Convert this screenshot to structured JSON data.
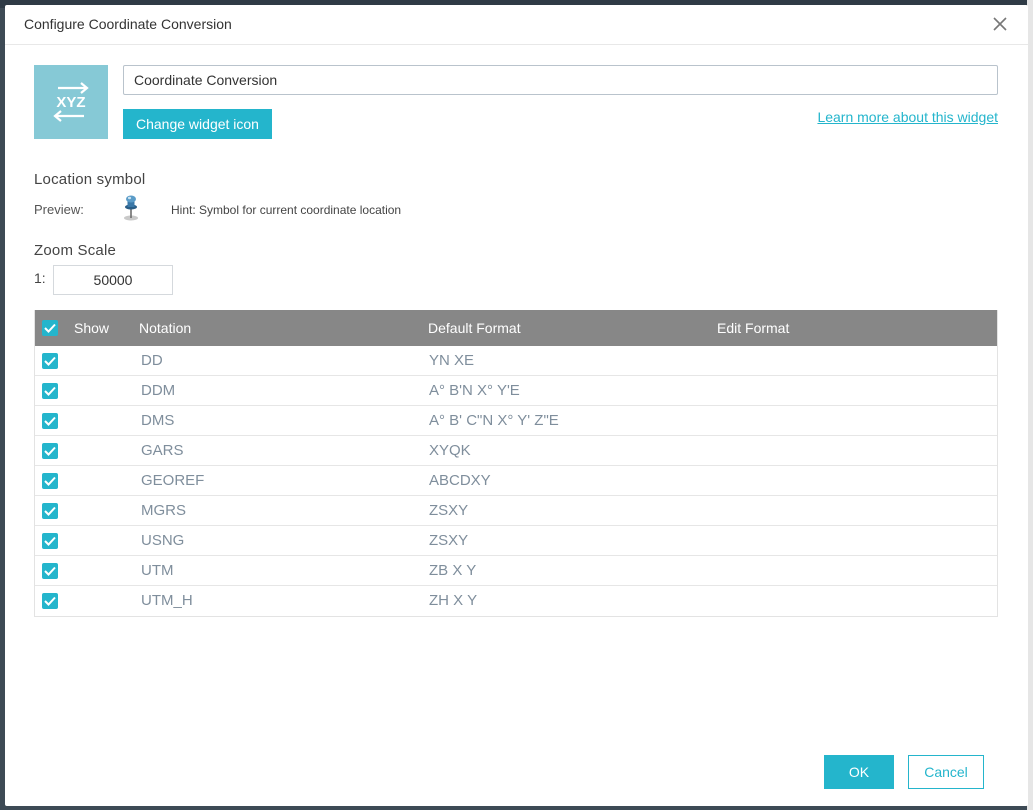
{
  "dialog": {
    "title": "Configure Coordinate Conversion",
    "close_icon": "close-icon"
  },
  "widget": {
    "icon_text": "XYZ",
    "icon_color": "#86c9d6",
    "name_value": "Coordinate Conversion",
    "change_icon_label": "Change widget icon",
    "learn_more_label": "Learn more about this widget"
  },
  "location_symbol": {
    "heading": "Location symbol",
    "preview_label": "Preview:",
    "pin_icon": "pushpin-icon",
    "hint": "Hint: Symbol for current coordinate location"
  },
  "zoom_scale": {
    "heading": "Zoom Scale",
    "prefix": "1:",
    "value": "50000"
  },
  "table": {
    "headers": {
      "show": "Show",
      "notation": "Notation",
      "default_format": "Default Format",
      "edit_format": "Edit Format"
    },
    "all_checked": true,
    "rows": [
      {
        "notation": "DD",
        "format": "YN XE",
        "checked": true
      },
      {
        "notation": "DDM",
        "format": "A° B'N X° Y'E",
        "checked": true
      },
      {
        "notation": "DMS",
        "format": "A° B' C\"N X° Y' Z\"E",
        "checked": true
      },
      {
        "notation": "GARS",
        "format": "XYQK",
        "checked": true
      },
      {
        "notation": "GEOREF",
        "format": "ABCDXY",
        "checked": true
      },
      {
        "notation": "MGRS",
        "format": "ZSXY",
        "checked": true
      },
      {
        "notation": "USNG",
        "format": "ZSXY",
        "checked": true
      },
      {
        "notation": "UTM",
        "format": "ZB X Y",
        "checked": true
      },
      {
        "notation": "UTM_H",
        "format": "ZH X Y",
        "checked": true
      }
    ]
  },
  "footer": {
    "ok_label": "OK",
    "cancel_label": "Cancel"
  },
  "colors": {
    "accent": "#24b5cc",
    "table_header": "#878787",
    "row_text": "#7f8e9c"
  }
}
